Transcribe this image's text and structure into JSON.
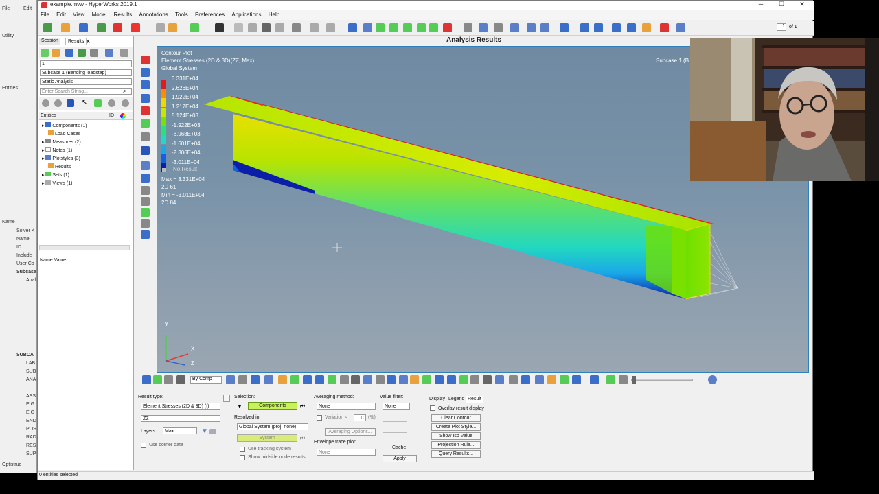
{
  "window": {
    "title": "example.mvw - HyperWorks 2019.1"
  },
  "bg_app": {
    "menu": [
      "File",
      "Edit"
    ],
    "labels": [
      "Utility",
      "Entities",
      "Name",
      "Solver K",
      "Name",
      "ID",
      "Include",
      "User Co",
      "Subcase",
      "Anal",
      "SUBCA",
      "LAB",
      "SUB",
      "ANA",
      "ASS",
      "EIG",
      "EIG",
      "END",
      "POS",
      "RAD",
      "RES",
      "SUP",
      "Optistruc"
    ]
  },
  "menu": [
    "File",
    "Edit",
    "View",
    "Model",
    "Results",
    "Annotations",
    "Tools",
    "Preferences",
    "Applications",
    "Help"
  ],
  "page_indicator": {
    "value": "1",
    "of": "of 1"
  },
  "panel_title": "Analysis Results",
  "browser": {
    "tabs": [
      "Session",
      "Results"
    ],
    "field1": "1",
    "subcase": "Subcase 1 (Bending loadstep)",
    "analysis": "Static Analysis",
    "search_placeholder": "Enter Search String...",
    "header": {
      "entities": "Entities",
      "id": "ID"
    },
    "tree": [
      "Components (1)",
      "Load Cases",
      "Measures (2)",
      "Notes (1)",
      "Plotstyles (3)",
      "Results",
      "Sets (1)",
      "Views (1)"
    ],
    "props_header": "Name Value"
  },
  "viewport": {
    "title": "Contour Plot",
    "subtitle": "Element Stresses (2D & 3D)(ZZ, Max)",
    "system": "Global System",
    "subcase_label": "Subcase 1 (B",
    "legend": [
      {
        "label": "3.331E+04",
        "color": "#e41a1c"
      },
      {
        "label": "2.626E+04",
        "color": "#ff8c00"
      },
      {
        "label": "1.922E+04",
        "color": "#f2d600"
      },
      {
        "label": "1.217E+04",
        "color": "#c7e600"
      },
      {
        "label": "5.124E+03",
        "color": "#7ae000"
      },
      {
        "label": "-1.922E+03",
        "color": "#2ee07a"
      },
      {
        "label": "-8.968E+03",
        "color": "#22d8c0"
      },
      {
        "label": "-1.601E+04",
        "color": "#1aa8e8"
      },
      {
        "label": "-2.306E+04",
        "color": "#1460e0"
      },
      {
        "label": "-3.011E+04",
        "color": "#0a1ea8"
      }
    ],
    "no_result": "No Result",
    "max_label": "Max = 3.331E+04",
    "max_elem": "2D 61",
    "min_label": "Min = -3.011E+04",
    "min_elem": "2D 84",
    "axis": {
      "y": "Y",
      "x": "X",
      "z": "Z"
    }
  },
  "bottom": {
    "result_type_label": "Result type:",
    "result_type": "Element Stresses (2D & 3D) (t)",
    "component": "ZZ",
    "layers_label": "Layers:",
    "layers": "Max",
    "use_corner": "Use corner data",
    "selection_label": "Selection:",
    "components_btn": "Components",
    "resolved_label": "Resolved in:",
    "resolved": "Global System (proj: none)",
    "system_btn": "System",
    "tracking": "Use tracking system",
    "midside": "Show midside node results",
    "averaging_label": "Averaging method:",
    "averaging": "None",
    "variation": "Variation <",
    "variation_val": "10",
    "variation_unit": "(%)",
    "averaging_options": "Averaging Options...",
    "envelope_label": "Envelope trace plot:",
    "envelope": "None",
    "value_filter_label": "Value filter:",
    "value_filter": "None",
    "cache": "Cache",
    "apply": "Apply",
    "tabs": [
      "Display",
      "Legend",
      "Result"
    ],
    "overlay": "Overlay result display",
    "buttons": [
      "Clear Contour",
      "Create Plot Style...",
      "Show Iso Value",
      "Projection Rule...",
      "Query Results..."
    ]
  },
  "anim_bar": {
    "by_comp": "By Comp"
  },
  "status": {
    "text": "0 entities selected"
  }
}
